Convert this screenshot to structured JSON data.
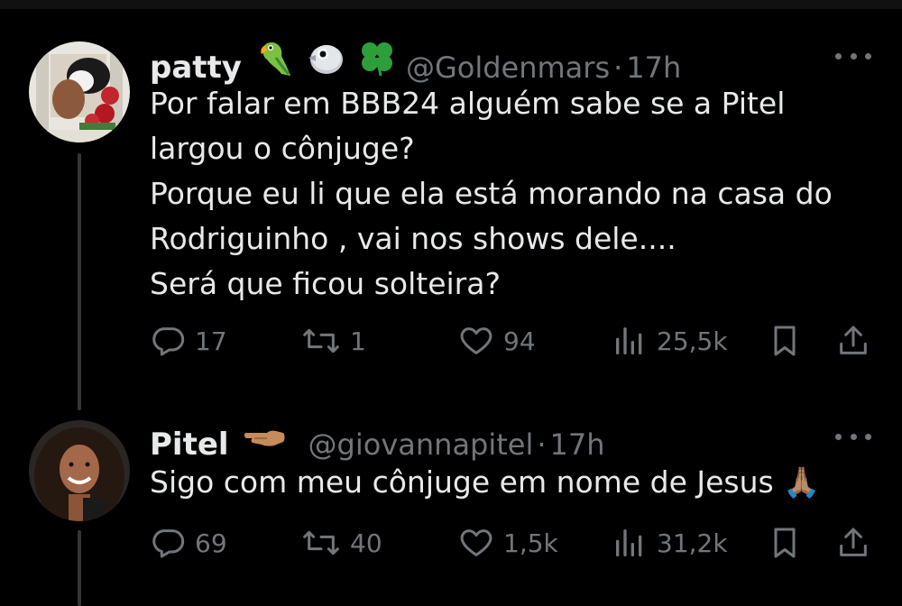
{
  "tweets": [
    {
      "name": "patty",
      "emojis": [
        "🦜",
        "🐦",
        "🍀"
      ],
      "handle": "@Goldenmars",
      "dot": "·",
      "time": "17h",
      "lines": [
        "Por falar em BBB24 alguém sabe se a Pitel",
        "largou o cônjuge?",
        "Porque eu li que ela está morando na casa do",
        "Rodriguinho , vai nos shows dele....",
        "Será que ficou solteira?"
      ],
      "replies": "17",
      "retweets": "1",
      "likes": "94",
      "views": "25,5k"
    },
    {
      "name": "Pitel",
      "emojis": [
        "👈🏽"
      ],
      "handle": "@giovannapitel",
      "dot": "·",
      "time": "17h",
      "lines": [
        "Sigo com meu cônjuge em nome de Jesus 🙏🏽"
      ],
      "replies": "69",
      "retweets": "40",
      "likes": "1,5k",
      "views": "31,2k"
    }
  ],
  "icons": {
    "reply": "reply-icon",
    "retweet": "retweet-icon",
    "like": "heart-icon",
    "views": "views-icon",
    "bookmark": "bookmark-icon",
    "share": "share-icon",
    "more": "more-icon"
  },
  "colors": {
    "background": "#000000",
    "text": "#e7e9ea",
    "muted": "#71767b",
    "thread_line": "#333639"
  }
}
